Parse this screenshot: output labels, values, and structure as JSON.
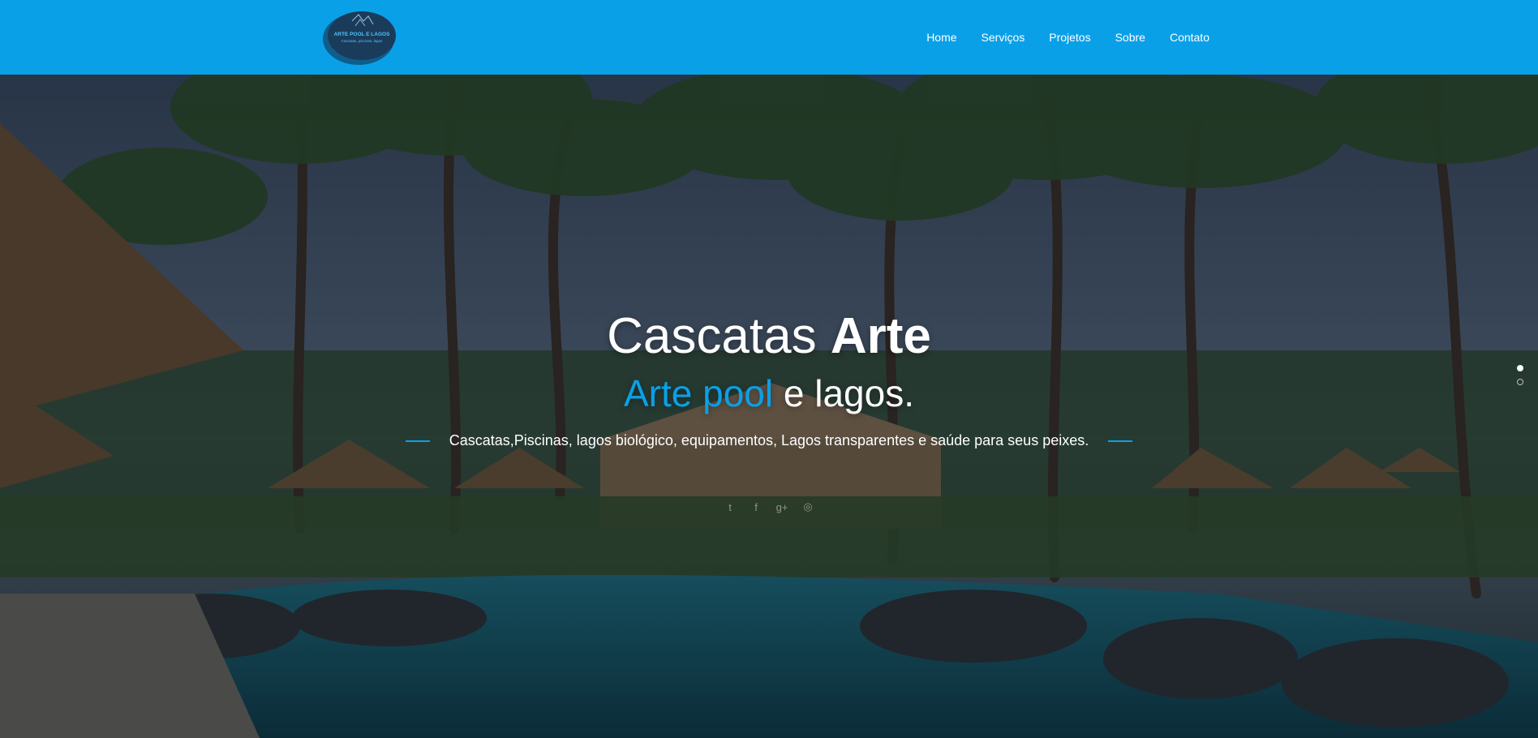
{
  "brand": {
    "logo_text": "ARTE POOL E LAGOS",
    "logo_tagline": "Cascatas, piscinas, lagos"
  },
  "nav": {
    "items": [
      {
        "label": "Home"
      },
      {
        "label": "Serviços"
      },
      {
        "label": "Projetos"
      },
      {
        "label": "Sobre"
      },
      {
        "label": "Contato"
      }
    ]
  },
  "hero": {
    "title_light": "Cascatas ",
    "title_bold": "Arte",
    "subtitle_accent": "Arte pool",
    "subtitle_rest": " e lagos.",
    "tagline": "Cascatas,Piscinas, lagos biológico, equipamentos, Lagos transparentes e saúde para seus peixes.",
    "social": [
      {
        "icon": "twitter-icon",
        "glyph": "t"
      },
      {
        "icon": "facebook-icon",
        "glyph": "f"
      },
      {
        "icon": "google-plus-icon",
        "glyph": "g+"
      },
      {
        "icon": "dribbble-icon",
        "glyph": "◎"
      }
    ],
    "slides_total": 2,
    "slide_active": 1
  },
  "colors": {
    "brand_blue": "#0aa0e8",
    "logo_navy": "#1b3b5a"
  }
}
